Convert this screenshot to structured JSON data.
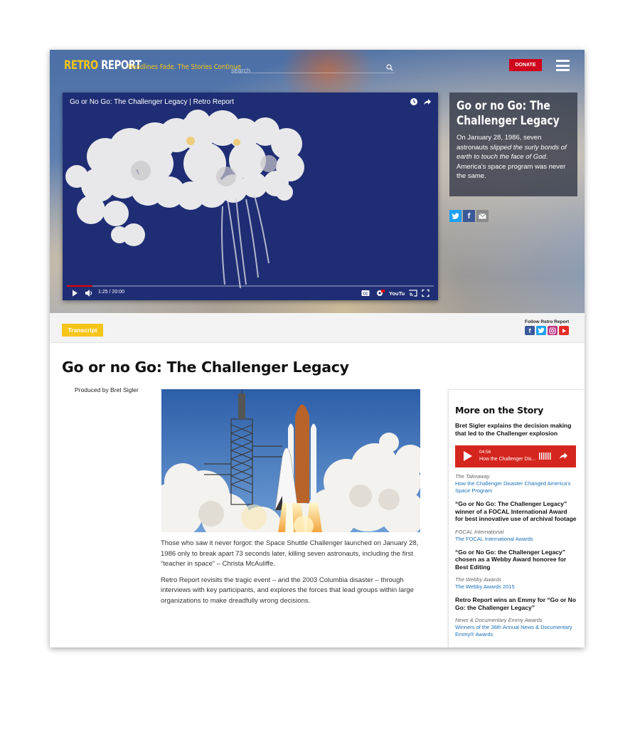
{
  "header": {
    "logo_retro": "RETRO",
    "logo_report": "REPORT",
    "tagline": "Headlines Fade. The Stories Continue",
    "search_placeholder": "search",
    "donate_label": "DONATE"
  },
  "video": {
    "title": "Go or No Go: The Challenger Legacy | Retro Report",
    "time": "1:25 / 20:00",
    "progress": 0.07,
    "youtube_label": "YouTube"
  },
  "info": {
    "title": "Go or no Go: The Challenger Legacy",
    "desc_1": "On January 28, 1986, seven astronauts ",
    "desc_italic": "slipped the surly bonds of earth to touch the face of God.",
    "desc_2": " America's space program was never the same."
  },
  "strip": {
    "transcript_label": "Transcript",
    "follow_label": "Follow Retro Report"
  },
  "article": {
    "title": "Go or no Go: The Challenger Legacy",
    "byline": "Produced by Bret Sigler",
    "para_1": "Those who saw it never forgot: the Space Shuttle Challenger launched on January 28, 1986 only to break apart 73 seconds later, killing seven astronauts, including the first “teacher in space” – Christa McAuliffe.",
    "para_2": "Retro Report revisits the tragic event  – and the 2003 Columbia disaster – through interviews with key participants, and explores the forces that lead groups within large organizations to make dreadfully wrong decisions."
  },
  "sidebar": {
    "heading": "More on the Story",
    "lead": "Bret Sigler explains the decision making that led to the Challenger explosion",
    "player": {
      "duration": "04:56",
      "title": "How the Challenger Dis..."
    },
    "stories": [
      {
        "source": "The Takeaway",
        "link": "How the Challenger Disaster Changed America's Space Program"
      },
      {
        "headline": "“Go or No Go: The Challenger Legacy” winner of a FOCAL International Award for best innovative use of archival footage",
        "source": "FOCAL International",
        "link": "The FOCAL International Awards"
      },
      {
        "headline": "“Go or No Go: the Challenger Legacy” chosen as a Webby Award honoree for Best Editing",
        "source": "The Webby Awards",
        "link": "The Webby Awards 2015"
      },
      {
        "headline": "Retro Report wins an Emmy for “Go or No Go: the Challenger Legacy”",
        "source": "News & Documentary Emmy Awards",
        "link": "Winners of the 36th Annual News & Documentary Emmy® Awards"
      }
    ]
  },
  "colors": {
    "brand_yellow": "#f5c518",
    "donate_red": "#d0021b",
    "player_red": "#d4261e",
    "link_blue": "#1a6fb7"
  }
}
